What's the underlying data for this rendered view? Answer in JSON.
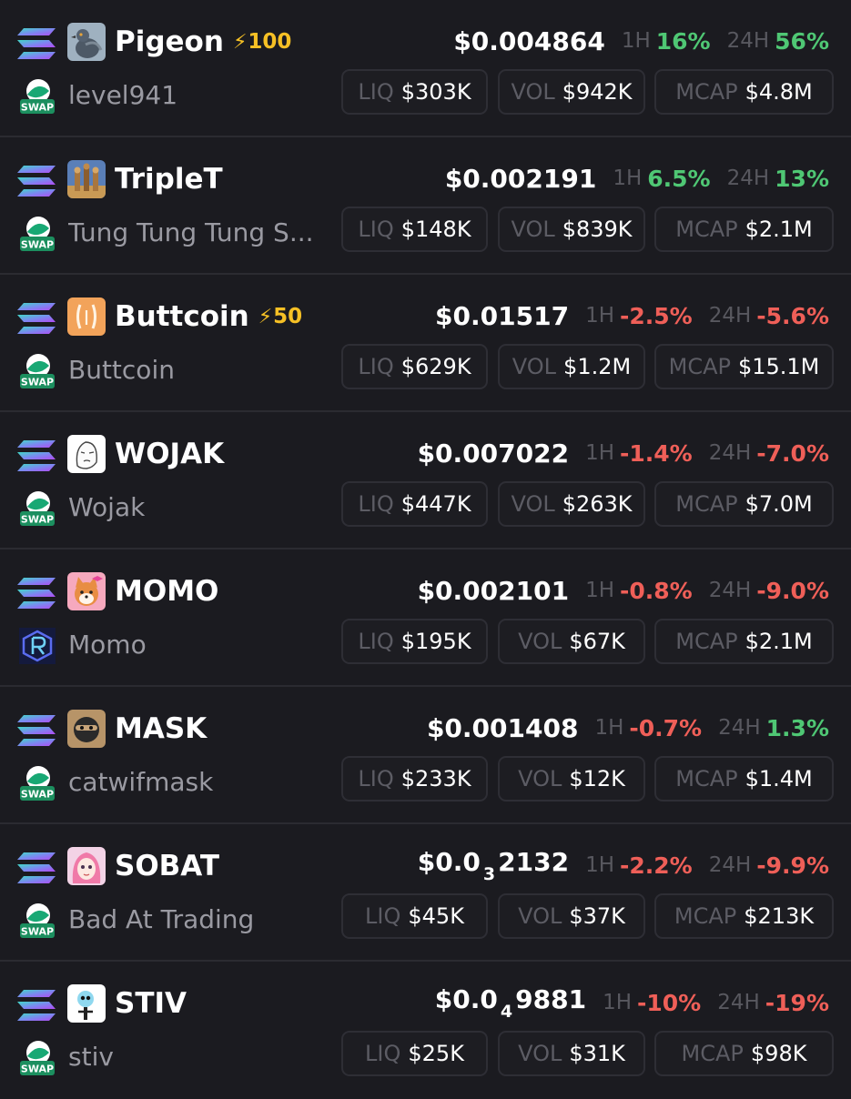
{
  "colors": {
    "background": "#1b1b20",
    "positive": "#4fc774",
    "negative": "#ef5f58",
    "boost": "#f6c025",
    "label": "#58585f"
  },
  "icons": {
    "chain": "solana-icon",
    "dex_swap": "swap-icon",
    "dex_raydium": "raydium-icon",
    "boost": "lightning-bolt-icon"
  },
  "labels": {
    "h1": "1H",
    "h24": "24H",
    "liq": "LIQ",
    "vol": "VOL",
    "mcap": "MCAP",
    "swap": "SWAP",
    "bolt": "⚡"
  },
  "tokens": [
    {
      "symbol": "Pigeon",
      "boost": "100",
      "name": "level941",
      "dex": "swap",
      "price": "$0.004864",
      "price_zeros": "",
      "price_rest": "",
      "h1": "16%",
      "h1_dir": "pos",
      "h24": "56%",
      "h24_dir": "pos",
      "liq": "$303K",
      "vol": "$942K",
      "mcap": "$4.8M",
      "avatar": "pigeon"
    },
    {
      "symbol": "TripleT",
      "boost": "",
      "name": "Tung Tung Tung S...",
      "dex": "swap",
      "price": "$0.002191",
      "price_zeros": "",
      "price_rest": "",
      "h1": "6.5%",
      "h1_dir": "pos",
      "h24": "13%",
      "h24_dir": "pos",
      "liq": "$148K",
      "vol": "$839K",
      "mcap": "$2.1M",
      "avatar": "triplet"
    },
    {
      "symbol": "Buttcoin",
      "boost": "50",
      "name": "Buttcoin",
      "dex": "swap",
      "price": "$0.01517",
      "price_zeros": "",
      "price_rest": "",
      "h1": "-2.5%",
      "h1_dir": "neg",
      "h24": "-5.6%",
      "h24_dir": "neg",
      "liq": "$629K",
      "vol": "$1.2M",
      "mcap": "$15.1M",
      "avatar": "buttcoin"
    },
    {
      "symbol": "WOJAK",
      "boost": "",
      "name": "Wojak",
      "dex": "swap",
      "price": "$0.007022",
      "price_zeros": "",
      "price_rest": "",
      "h1": "-1.4%",
      "h1_dir": "neg",
      "h24": "-7.0%",
      "h24_dir": "neg",
      "liq": "$447K",
      "vol": "$263K",
      "mcap": "$7.0M",
      "avatar": "wojak"
    },
    {
      "symbol": "MOMO",
      "boost": "",
      "name": "Momo",
      "dex": "raydium",
      "price": "$0.002101",
      "price_zeros": "",
      "price_rest": "",
      "h1": "-0.8%",
      "h1_dir": "neg",
      "h24": "-9.0%",
      "h24_dir": "neg",
      "liq": "$195K",
      "vol": "$67K",
      "mcap": "$2.1M",
      "avatar": "momo"
    },
    {
      "symbol": "MASK",
      "boost": "",
      "name": "catwifmask",
      "dex": "swap",
      "price": "$0.001408",
      "price_zeros": "",
      "price_rest": "",
      "h1": "-0.7%",
      "h1_dir": "neg",
      "h24": "1.3%",
      "h24_dir": "pos",
      "liq": "$233K",
      "vol": "$12K",
      "mcap": "$1.4M",
      "avatar": "mask"
    },
    {
      "symbol": "SOBAT",
      "boost": "",
      "name": "Bad At Trading",
      "dex": "swap",
      "price": "$0.0",
      "price_zeros": "3",
      "price_rest": "2132",
      "h1": "-2.2%",
      "h1_dir": "neg",
      "h24": "-9.9%",
      "h24_dir": "neg",
      "liq": "$45K",
      "vol": "$37K",
      "mcap": "$213K",
      "avatar": "sobat"
    },
    {
      "symbol": "STIV",
      "boost": "",
      "name": "stiv",
      "dex": "swap",
      "price": "$0.0",
      "price_zeros": "4",
      "price_rest": "9881",
      "h1": "-10%",
      "h1_dir": "neg",
      "h24": "-19%",
      "h24_dir": "neg",
      "liq": "$25K",
      "vol": "$31K",
      "mcap": "$98K",
      "avatar": "stiv"
    }
  ]
}
